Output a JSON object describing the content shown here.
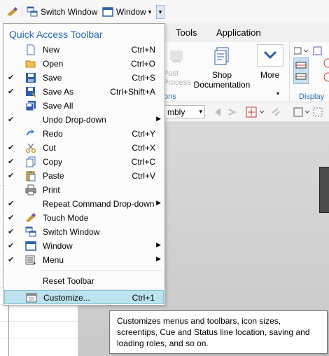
{
  "qat": {
    "switch_window_label": "Switch Window",
    "window_label": "Window",
    "dropdown_glyph": "▾"
  },
  "menu_bar": {
    "tools": "Tools",
    "application": "Application"
  },
  "ribbon": {
    "post_process": "Post\nProcess",
    "shop_documentation": "Shop\nDocumentation",
    "more": "More",
    "operations_fragment": "ons",
    "display": "Display",
    "assembly_fragment": "mbly"
  },
  "menu": {
    "title": "Quick Access Toolbar",
    "items": [
      {
        "label": "New",
        "shortcut": "Ctrl+N",
        "checked": false,
        "icon": "new-file-icon",
        "arrow": false
      },
      {
        "label": "Open",
        "shortcut": "Ctrl+O",
        "checked": false,
        "icon": "open-folder-icon",
        "arrow": false
      },
      {
        "label": "Save",
        "shortcut": "Ctrl+S",
        "checked": true,
        "icon": "save-icon",
        "arrow": false
      },
      {
        "label": "Save As",
        "shortcut": "Ctrl+Shift+A",
        "checked": true,
        "icon": "save-as-icon",
        "arrow": false
      },
      {
        "label": "Save All",
        "shortcut": "",
        "checked": false,
        "icon": "save-all-icon",
        "arrow": false
      },
      {
        "label": "Undo Drop-down",
        "shortcut": "",
        "checked": true,
        "icon": "undo-icon",
        "arrow": true
      },
      {
        "label": "Redo",
        "shortcut": "Ctrl+Y",
        "checked": false,
        "icon": "redo-icon",
        "arrow": false
      },
      {
        "label": "Cut",
        "shortcut": "Ctrl+X",
        "checked": true,
        "icon": "cut-icon",
        "arrow": false
      },
      {
        "label": "Copy",
        "shortcut": "Ctrl+C",
        "checked": true,
        "icon": "copy-icon",
        "arrow": false
      },
      {
        "label": "Paste",
        "shortcut": "Ctrl+V",
        "checked": true,
        "icon": "paste-icon",
        "arrow": false
      },
      {
        "label": "Print",
        "shortcut": "",
        "checked": false,
        "icon": "print-icon",
        "arrow": false
      },
      {
        "label": "Repeat Command Drop-down",
        "shortcut": "",
        "checked": true,
        "icon": "repeat-icon",
        "arrow": true
      },
      {
        "label": "Touch Mode",
        "shortcut": "",
        "checked": true,
        "icon": "touch-mode-icon",
        "arrow": false
      },
      {
        "label": "Switch Window",
        "shortcut": "",
        "checked": true,
        "icon": "switch-window-icon",
        "arrow": false
      },
      {
        "label": "Window",
        "shortcut": "",
        "checked": true,
        "icon": "window-icon",
        "arrow": true
      },
      {
        "label": "Menu",
        "shortcut": "",
        "checked": true,
        "icon": "menu-icon",
        "arrow": true
      }
    ],
    "reset_label": "Reset Toolbar",
    "customize_label": "Customize...",
    "customize_shortcut": "Ctrl+1",
    "check_glyph": "✔",
    "submenu_glyph": "▶"
  },
  "tooltip": {
    "text": "Customizes menus and toolbars, icon sizes, screentips, Cue and Status line location, saving and loading roles, and so on."
  },
  "colors": {
    "title_blue": "#2b6cb0",
    "selected_bg": "#bde3ee",
    "display_blue": "#2b6cb0"
  }
}
